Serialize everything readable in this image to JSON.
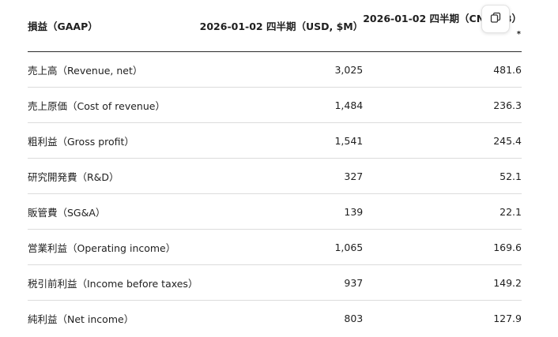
{
  "table": {
    "headers": {
      "label": "損益（GAAP）",
      "usd": "2026-01-02 四半期（USD, $M）",
      "cny": "2026-01-02 四半期（CNY, ¥B）",
      "asterisk": "*"
    },
    "rows": [
      {
        "label": "売上高（Revenue, net）",
        "usd": "3,025",
        "cny": "481.6"
      },
      {
        "label": "売上原価（Cost of revenue）",
        "usd": "1,484",
        "cny": "236.3"
      },
      {
        "label": "粗利益（Gross profit）",
        "usd": "1,541",
        "cny": "245.4"
      },
      {
        "label": "研究開発費（R&D）",
        "usd": "327",
        "cny": "52.1"
      },
      {
        "label": "販管費（SG&A）",
        "usd": "139",
        "cny": "22.1"
      },
      {
        "label": "営業利益（Operating income）",
        "usd": "1,065",
        "cny": "169.6"
      },
      {
        "label": "税引前利益（Income before taxes）",
        "usd": "937",
        "cny": "149.2"
      },
      {
        "label": "純利益（Net income）",
        "usd": "803",
        "cny": "127.9"
      }
    ]
  },
  "copy_button": {
    "icon": "copy-icon"
  }
}
